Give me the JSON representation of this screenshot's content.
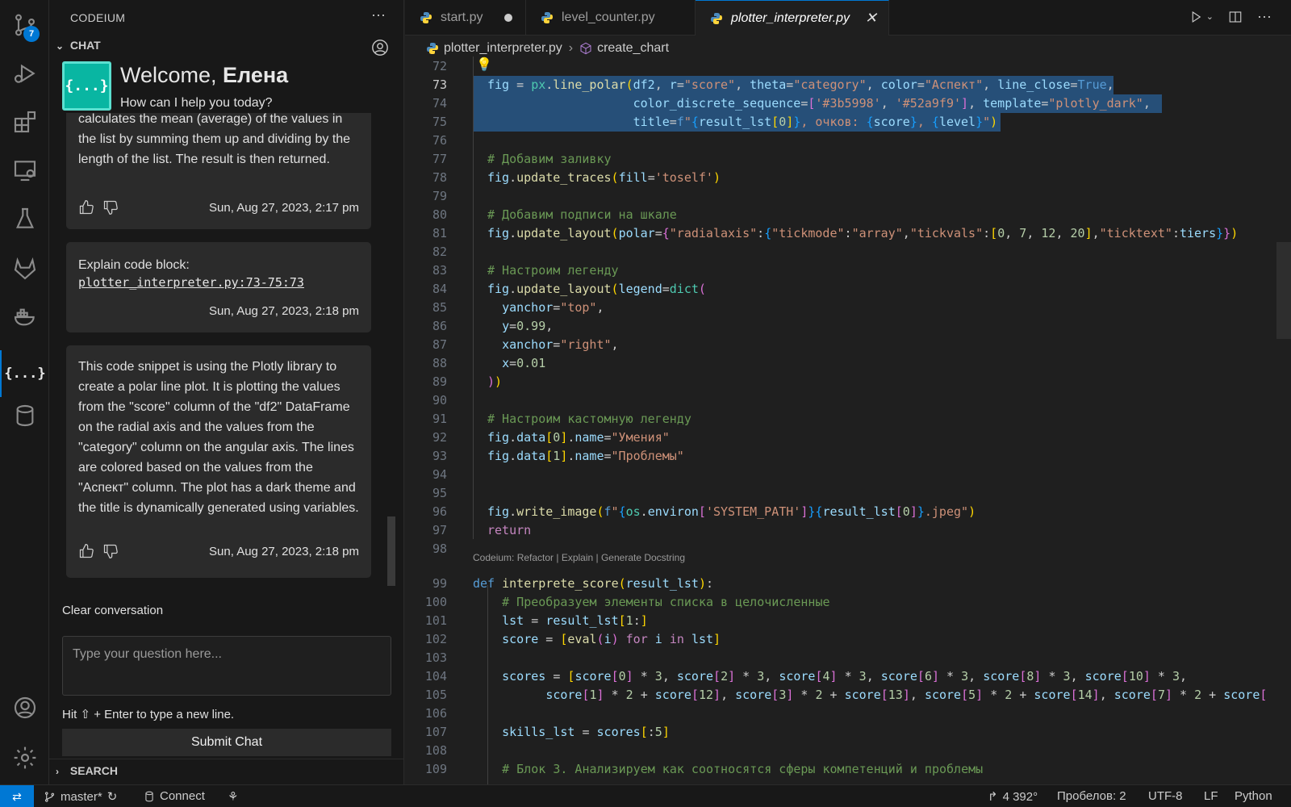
{
  "activity_bar": {
    "source_control_badge": "7",
    "codeium_glyph": "{...}"
  },
  "sidebar": {
    "title": "CODEIUM",
    "more_glyph": "···",
    "chat_section": "CHAT",
    "search_section": "SEARCH",
    "welcome_prefix": "Welcome, ",
    "welcome_name": "Елена",
    "welcome_subtitle": "How can I help you today?",
    "logo_glyph": "{...}",
    "messages": [
      {
        "text": "calculates the mean (average) of the values in the list by summing them up and dividing by the length of the list. The result is then returned.",
        "time": "Sun, Aug 27, 2023, 2:17 pm"
      },
      {
        "prefix": "Explain code block:",
        "link": "plotter_interpreter.py:73-75:73",
        "time": "Sun, Aug 27, 2023, 2:18 pm"
      },
      {
        "text": "This code snippet is using the Plotly library to create a polar line plot. It is plotting the values from the \"score\" column of the \"df2\" DataFrame on the radial axis and the values from the \"category\" column on the angular axis. The lines are colored based on the values from the \"Аспект\" column. The plot has a dark theme and the title is dynamically generated using variables.",
        "time": "Sun, Aug 27, 2023, 2:18 pm"
      }
    ],
    "clear_conversation": "Clear conversation",
    "input_placeholder": "Type your question here...",
    "hint": "Hit ⇧ + Enter to type a new line.",
    "submit_label": "Submit Chat"
  },
  "tabs": [
    {
      "label": "start.py",
      "dirty": true
    },
    {
      "label": "level_counter.py"
    },
    {
      "label": "plotter_interpreter.py",
      "active": true
    }
  ],
  "breadcrumb": {
    "file": "plotter_interpreter.py",
    "symbol": "create_chart"
  },
  "code_lens": "Codeium: Refactor | Explain | Generate Docstring",
  "code_lines": [
    {
      "n": "72",
      "html": ""
    },
    {
      "n": "73",
      "html": "<span class=\"v\">fig</span> = <span class=\"t\">px</span>.<span class=\"f\">line_polar</span><span class=\"p1\">(</span><span class=\"v\">df2</span>, <span class=\"v\">r</span>=<span class=\"s\">\"score\"</span>, <span class=\"v\">theta</span>=<span class=\"s\">\"category\"</span>, <span class=\"v\">color</span>=<span class=\"s\">\"Аспект\"</span>, <span class=\"v\">line_close</span>=<span class=\"k\">True</span>,"
    },
    {
      "n": "74",
      "html": "                    <span class=\"v\">color_discrete_sequence</span>=<span class=\"p2\">[</span><span class=\"s\">'#3b5998'</span>, <span class=\"s\">'#52a9f9'</span><span class=\"p2\">]</span>, <span class=\"v\">template</span>=<span class=\"s\">\"plotly_dark\"</span>,"
    },
    {
      "n": "75",
      "html": "                    <span class=\"v\">title</span>=<span class=\"k\">f</span><span class=\"s\">\"</span><span class=\"p3\">{</span><span class=\"v\">result_lst</span><span class=\"p1\">[</span><span class=\"n\">0</span><span class=\"p1\">]</span><span class=\"p3\">}</span><span class=\"s\">, очков: </span><span class=\"p3\">{</span><span class=\"v\">score</span><span class=\"p3\">}</span><span class=\"s\">, </span><span class=\"p3\">{</span><span class=\"v\">level</span><span class=\"p3\">}</span><span class=\"s\">\"</span><span class=\"p1\">)</span>"
    },
    {
      "n": "76",
      "html": ""
    },
    {
      "n": "77",
      "html": "<span class=\"c\"># Добавим заливку</span>"
    },
    {
      "n": "78",
      "html": "<span class=\"v\">fig</span>.<span class=\"f\">update_traces</span><span class=\"p1\">(</span><span class=\"v\">fill</span>=<span class=\"s\">'toself'</span><span class=\"p1\">)</span>"
    },
    {
      "n": "79",
      "html": ""
    },
    {
      "n": "80",
      "html": "<span class=\"c\"># Добавим подписи на шкале</span>"
    },
    {
      "n": "81",
      "html": "<span class=\"v\">fig</span>.<span class=\"f\">update_layout</span><span class=\"p1\">(</span><span class=\"v\">polar</span>=<span class=\"p2\">{</span><span class=\"s\">\"radialaxis\"</span>:<span class=\"p3\">{</span><span class=\"s\">\"tickmode\"</span>:<span class=\"s\">\"array\"</span>,<span class=\"s\">\"tickvals\"</span>:<span class=\"p1\">[</span><span class=\"n\">0</span>, <span class=\"n\">7</span>, <span class=\"n\">12</span>, <span class=\"n\">20</span><span class=\"p1\">]</span>,<span class=\"s\">\"ticktext\"</span>:<span class=\"v\">tiers</span><span class=\"p3\">}</span><span class=\"p2\">}</span><span class=\"p1\">)</span>"
    },
    {
      "n": "82",
      "html": ""
    },
    {
      "n": "83",
      "html": "<span class=\"c\"># Настроим легенду</span>"
    },
    {
      "n": "84",
      "html": "<span class=\"v\">fig</span>.<span class=\"f\">update_layout</span><span class=\"p1\">(</span><span class=\"v\">legend</span>=<span class=\"t\">dict</span><span class=\"p2\">(</span>"
    },
    {
      "n": "85",
      "html": "  <span class=\"v\">yanchor</span>=<span class=\"s\">\"top\"</span>,"
    },
    {
      "n": "86",
      "html": "  <span class=\"v\">y</span>=<span class=\"n\">0.99</span>,"
    },
    {
      "n": "87",
      "html": "  <span class=\"v\">xanchor</span>=<span class=\"s\">\"right\"</span>,"
    },
    {
      "n": "88",
      "html": "  <span class=\"v\">x</span>=<span class=\"n\">0.01</span>"
    },
    {
      "n": "89",
      "html": "<span class=\"p2\">)</span><span class=\"p1\">)</span>"
    },
    {
      "n": "90",
      "html": ""
    },
    {
      "n": "91",
      "html": "<span class=\"c\"># Настроим кастомную легенду</span>"
    },
    {
      "n": "92",
      "html": "<span class=\"v\">fig</span>.<span class=\"v\">data</span><span class=\"p1\">[</span><span class=\"n\">0</span><span class=\"p1\">]</span>.<span class=\"v\">name</span>=<span class=\"s\">\"Умения\"</span>"
    },
    {
      "n": "93",
      "html": "<span class=\"v\">fig</span>.<span class=\"v\">data</span><span class=\"p1\">[</span><span class=\"n\">1</span><span class=\"p1\">]</span>.<span class=\"v\">name</span>=<span class=\"s\">\"Проблемы\"</span>"
    },
    {
      "n": "94",
      "html": ""
    },
    {
      "n": "95",
      "html": ""
    },
    {
      "n": "96",
      "html": "<span class=\"v\">fig</span>.<span class=\"f\">write_image</span><span class=\"p1\">(</span><span class=\"k\">f</span><span class=\"s\">\"</span><span class=\"p3\">{</span><span class=\"t\">os</span>.<span class=\"v\">environ</span><span class=\"p2\">[</span><span class=\"s\">'SYSTEM_PATH'</span><span class=\"p2\">]</span><span class=\"p3\">}</span><span class=\"p3\">{</span><span class=\"v\">result_lst</span><span class=\"p2\">[</span><span class=\"n\">0</span><span class=\"p2\">]</span><span class=\"p3\">}</span><span class=\"s\">.jpeg\"</span><span class=\"p1\">)</span>"
    },
    {
      "n": "97",
      "html": "<span class=\"kw\">return</span>"
    },
    {
      "n": "98",
      "html": ""
    },
    {
      "n": "99",
      "html": "<span class=\"k\">def</span> <span class=\"f\">interprete_score</span><span class=\"p1\">(</span><span class=\"v\">result_lst</span><span class=\"p1\">)</span>:"
    },
    {
      "n": "100",
      "html": "    <span class=\"c\"># Преобразуем элементы списка в целочисленные</span>"
    },
    {
      "n": "101",
      "html": "    <span class=\"v\">lst</span> = <span class=\"v\">result_lst</span><span class=\"p1\">[</span><span class=\"n\">1</span>:<span class=\"p1\">]</span>"
    },
    {
      "n": "102",
      "html": "    <span class=\"v\">score</span> = <span class=\"p1\">[</span><span class=\"f\">eval</span><span class=\"p2\">(</span><span class=\"v\">i</span><span class=\"p2\">)</span> <span class=\"kw\">for</span> <span class=\"v\">i</span> <span class=\"kw\">in</span> <span class=\"v\">lst</span><span class=\"p1\">]</span>"
    },
    {
      "n": "103",
      "html": ""
    },
    {
      "n": "104",
      "html": "    <span class=\"v\">scores</span> = <span class=\"p1\">[</span><span class=\"v\">score</span><span class=\"p2\">[</span><span class=\"n\">0</span><span class=\"p2\">]</span> * <span class=\"n\">3</span>, <span class=\"v\">score</span><span class=\"p2\">[</span><span class=\"n\">2</span><span class=\"p2\">]</span> * <span class=\"n\">3</span>, <span class=\"v\">score</span><span class=\"p2\">[</span><span class=\"n\">4</span><span class=\"p2\">]</span> * <span class=\"n\">3</span>, <span class=\"v\">score</span><span class=\"p2\">[</span><span class=\"n\">6</span><span class=\"p2\">]</span> * <span class=\"n\">3</span>, <span class=\"v\">score</span><span class=\"p2\">[</span><span class=\"n\">8</span><span class=\"p2\">]</span> * <span class=\"n\">3</span>, <span class=\"v\">score</span><span class=\"p2\">[</span><span class=\"n\">10</span><span class=\"p2\">]</span> * <span class=\"n\">3</span>,"
    },
    {
      "n": "105",
      "html": "          <span class=\"v\">score</span><span class=\"p2\">[</span><span class=\"n\">1</span><span class=\"p2\">]</span> * <span class=\"n\">2</span> + <span class=\"v\">score</span><span class=\"p2\">[</span><span class=\"n\">12</span><span class=\"p2\">]</span>, <span class=\"v\">score</span><span class=\"p2\">[</span><span class=\"n\">3</span><span class=\"p2\">]</span> * <span class=\"n\">2</span> + <span class=\"v\">score</span><span class=\"p2\">[</span><span class=\"n\">13</span><span class=\"p2\">]</span>, <span class=\"v\">score</span><span class=\"p2\">[</span><span class=\"n\">5</span><span class=\"p2\">]</span> * <span class=\"n\">2</span> + <span class=\"v\">score</span><span class=\"p2\">[</span><span class=\"n\">14</span><span class=\"p2\">]</span>, <span class=\"v\">score</span><span class=\"p2\">[</span><span class=\"n\">7</span><span class=\"p2\">]</span> * <span class=\"n\">2</span> + <span class=\"v\">score</span><span class=\"p2\">[</span>"
    },
    {
      "n": "106",
      "html": ""
    },
    {
      "n": "107",
      "html": "    <span class=\"v\">skills_lst</span> = <span class=\"v\">scores</span><span class=\"p1\">[</span>:<span class=\"n\">5</span><span class=\"p1\">]</span>"
    },
    {
      "n": "108",
      "html": ""
    },
    {
      "n": "109",
      "html": "    <span class=\"c\"># Блок 3. Анализируем как соотносятся сферы компетенций и проблемы</span>"
    }
  ],
  "status_bar": {
    "branch": "master*",
    "connect": "Connect",
    "position": "4 392°",
    "indent": "Пробелов: 2",
    "encoding": "UTF-8",
    "eol": "LF",
    "language": "Python"
  },
  "colors": {
    "accent": "#0078d4",
    "codeium": "#09b6a2",
    "selection": "#264f78"
  }
}
